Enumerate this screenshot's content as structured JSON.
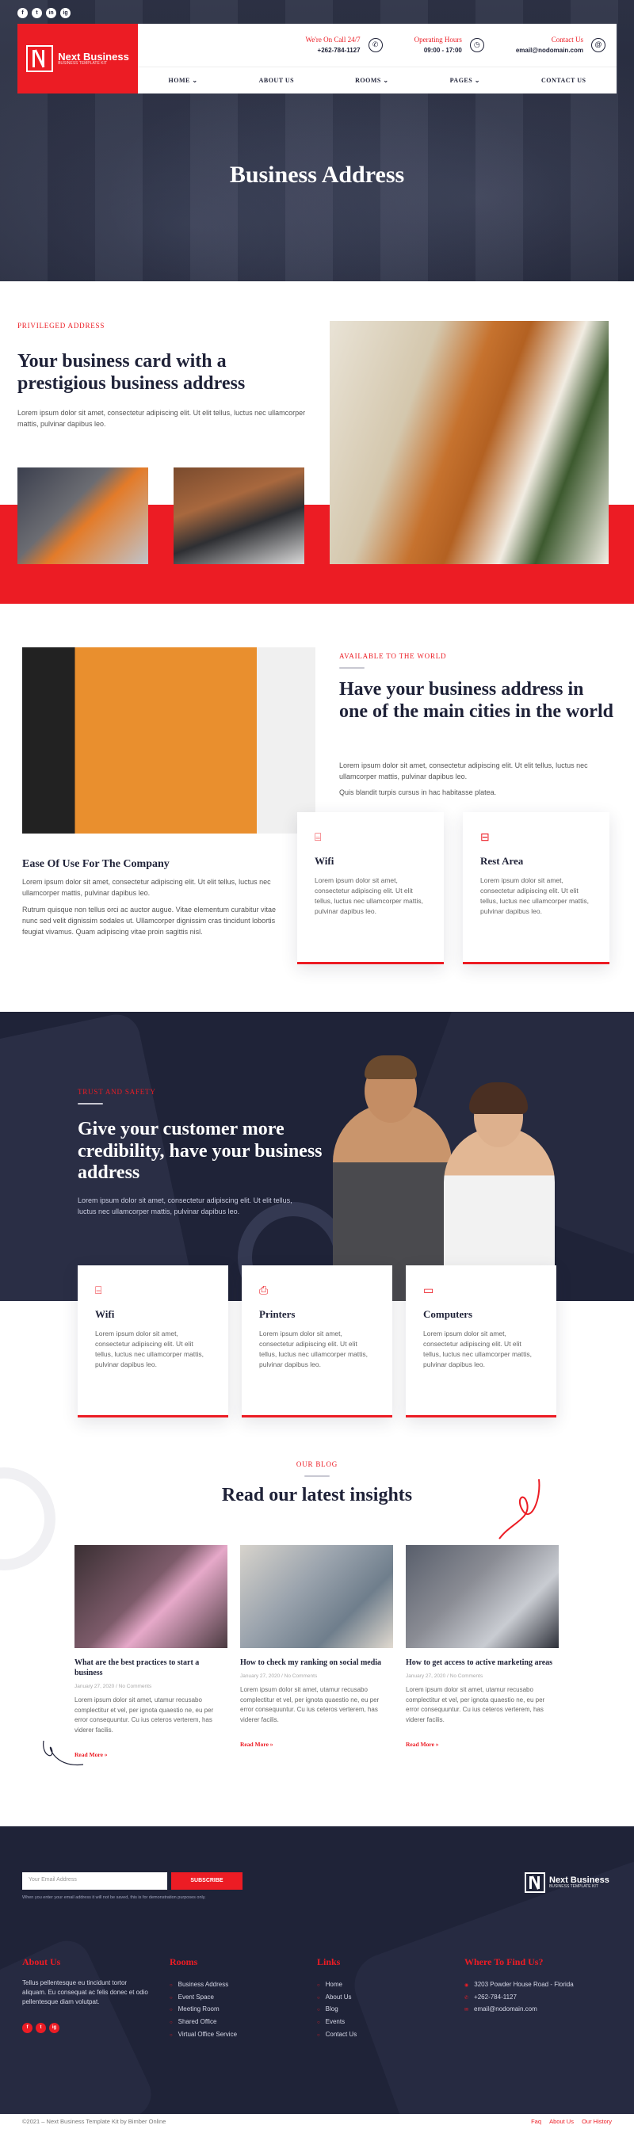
{
  "header": {
    "social": [
      "f",
      "t",
      "in",
      "ig"
    ],
    "logo_title": "Next Business",
    "logo_tagline": "BUSINESS TEMPLATE KIT",
    "call_title": "We're On Call 24/7",
    "call_value": "+262-784-1127",
    "hours_title": "Operating Hours",
    "hours_value": "09:00 - 17:00",
    "contact_title": "Contact Us",
    "contact_value": "email@nodomain.com",
    "nav": [
      "HOME",
      "ABOUT US",
      "ROOMS",
      "PAGES",
      "CONTACT US"
    ],
    "nav_dropdown": [
      true,
      false,
      true,
      true,
      false
    ]
  },
  "hero": {
    "title": "Business Address"
  },
  "s1": {
    "eyebrow": "PRIVILEGED ADDRESS",
    "title": "Your business card with a prestigious business address",
    "body": "Lorem ipsum dolor sit amet, consectetur adipiscing elit. Ut elit tellus, luctus nec ullamcorper mattis, pulvinar dapibus leo."
  },
  "s2": {
    "eyebrow": "AVAILABLE TO THE WORLD",
    "title": "Have your business address in one of the main cities in the world",
    "p1": "Lorem ipsum dolor sit amet, consectetur adipiscing elit. Ut elit tellus, luctus nec ullamcorper mattis, pulvinar dapibus leo.",
    "p2": "Quis blandit turpis cursus in hac habitasse platea.",
    "sub_title": "Ease Of Use For The Company",
    "p3": "Lorem ipsum dolor sit amet, consectetur adipiscing elit. Ut elit tellus, luctus nec ullamcorper mattis, pulvinar dapibus leo.",
    "p4": "Rutrum quisque non tellus orci ac auctor augue. Vitae elementum curabitur vitae nunc sed velit dignissim sodales ut. Ullamcorper dignissim cras tincidunt lobortis feugiat vivamus. Quam adipiscing vitae proin sagittis nisl.",
    "cards": [
      {
        "title": "Wifi",
        "icon": "wifi-router-icon",
        "text": "Lorem ipsum dolor sit amet, consectetur adipiscing elit. Ut elit tellus, luctus nec ullamcorper mattis, pulvinar dapibus leo."
      },
      {
        "title": "Rest Area",
        "icon": "sofa-icon",
        "text": "Lorem ipsum dolor sit amet, consectetur adipiscing elit. Ut elit tellus, luctus nec ullamcorper mattis, pulvinar dapibus leo."
      }
    ]
  },
  "s3": {
    "eyebrow": "TRUST AND SAFETY",
    "title": "Give your customer more credibility, have your business address",
    "body": "Lorem ipsum dolor sit amet, consectetur adipiscing elit. Ut elit tellus, luctus nec ullamcorper mattis, pulvinar dapibus leo.",
    "cards": [
      {
        "title": "Wifi",
        "icon": "wifi-router-icon",
        "text": "Lorem ipsum dolor sit amet, consectetur adipiscing elit. Ut elit tellus, luctus nec ullamcorper mattis, pulvinar dapibus leo."
      },
      {
        "title": "Printers",
        "icon": "printer-icon",
        "text": "Lorem ipsum dolor sit amet, consectetur adipiscing elit. Ut elit tellus, luctus nec ullamcorper mattis, pulvinar dapibus leo."
      },
      {
        "title": "Computers",
        "icon": "computer-icon",
        "text": "Lorem ipsum dolor sit amet, consectetur adipiscing elit. Ut elit tellus, luctus nec ullamcorper mattis, pulvinar dapibus leo."
      }
    ]
  },
  "blog": {
    "eyebrow": "OUR BLOG",
    "title": "Read our latest insights",
    "posts": [
      {
        "title": "What are the best practices to start a business",
        "meta": "January 27, 2020 / No Comments",
        "text": "Lorem ipsum dolor sit amet, utamur recusabo complectitur et vel, per ignota quaestio ne, eu per error consequuntur. Cu ius ceteros verterem, has viderer facilis.",
        "more": "Read More »"
      },
      {
        "title": "How to check my ranking on social media",
        "meta": "January 27, 2020 / No Comments",
        "text": "Lorem ipsum dolor sit amet, utamur recusabo complectitur et vel, per ignota quaestio ne, eu per error consequuntur. Cu ius ceteros verterem, has viderer facilis.",
        "more": "Read More »"
      },
      {
        "title": "How to get access to active marketing areas",
        "meta": "January 27, 2020 / No Comments",
        "text": "Lorem ipsum dolor sit amet, utamur recusabo complectitur et vel, per ignota quaestio ne, eu per error consequuntur. Cu ius ceteros verterem, has viderer facilis.",
        "more": "Read More »"
      }
    ]
  },
  "footer": {
    "email_placeholder": "Your Email Address",
    "subscribe": "SUBSCRIBE",
    "note": "When you enter your email address it will not be saved, this is for demonstration purposes only.",
    "logo_title": "Next Business",
    "logo_tagline": "BUSINESS TEMPLATE KIT",
    "about_title": "About Us",
    "about_text": "Tellus pellentesque eu tincidunt tortor aliquam. Eu consequat ac felis donec et odio pellentesque diam volutpat.",
    "social": [
      "f",
      "t",
      "ig"
    ],
    "rooms_title": "Rooms",
    "rooms": [
      "Business Address",
      "Event Space",
      "Meeting Room",
      "Shared Office",
      "Virtual Office Service"
    ],
    "links_title": "Links",
    "links": [
      "Home",
      "About Us",
      "Blog",
      "Events",
      "Contact Us"
    ],
    "where_title": "Where To Find Us?",
    "where": [
      "3203 Powder House Road - Florida",
      "+262-784-1127",
      "email@nodomain.com"
    ],
    "copyright": "©2021 – Next Business Template Kit by Bimber Online",
    "bottom_links": [
      "Faq",
      "About Us",
      "Our History"
    ]
  }
}
